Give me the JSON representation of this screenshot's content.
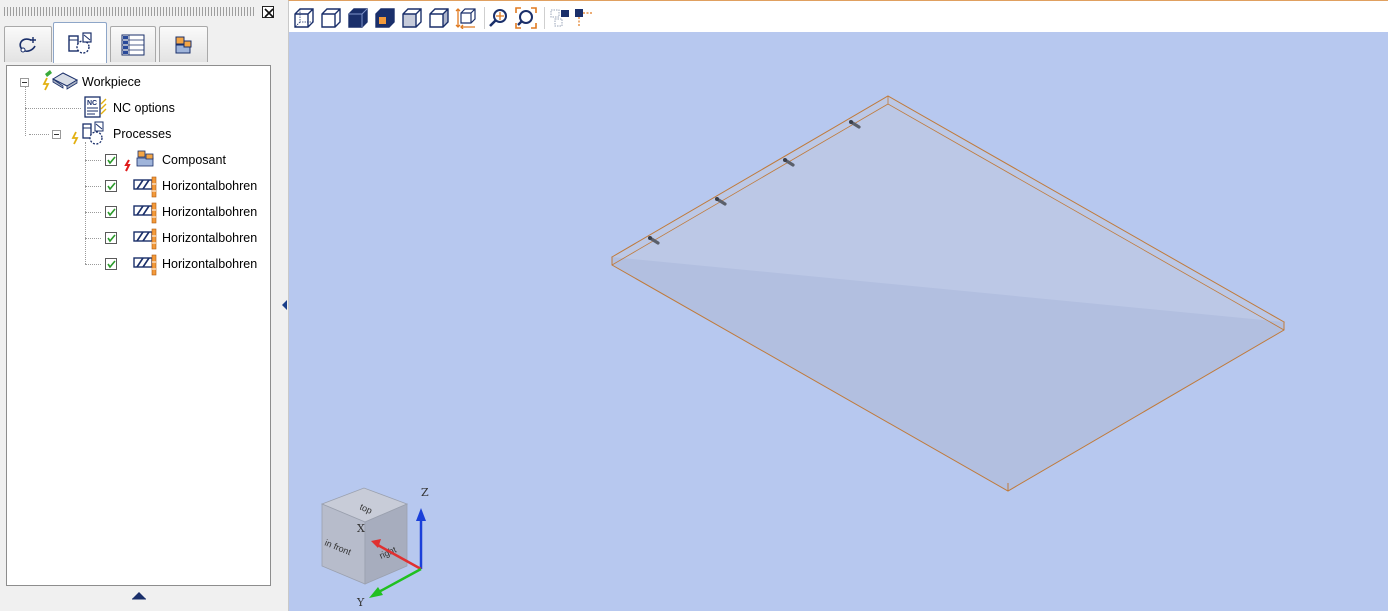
{
  "panel": {
    "tabs": [
      {
        "icon": "geometry-icon",
        "active": false
      },
      {
        "icon": "processes-icon",
        "active": true
      },
      {
        "icon": "nc-list-icon",
        "active": false
      },
      {
        "icon": "components-icon",
        "active": false
      }
    ]
  },
  "tree": {
    "workpiece": {
      "label": "Workpiece",
      "icon": "workpiece-icon",
      "expanded": true
    },
    "nc_options": {
      "label": "NC options",
      "icon": "nc-options-icon"
    },
    "processes": {
      "label": "Processes",
      "icon": "processes-icon",
      "expanded": true
    },
    "items": [
      {
        "label": "Composant",
        "icon": "composant-icon",
        "checked": true
      },
      {
        "label": "Horizontalbohren",
        "icon": "horizontal-drilling-icon",
        "checked": true
      },
      {
        "label": "Horizontalbohren",
        "icon": "horizontal-drilling-icon",
        "checked": true
      },
      {
        "label": "Horizontalbohren",
        "icon": "horizontal-drilling-icon",
        "checked": true
      },
      {
        "label": "Horizontalbohren",
        "icon": "horizontal-drilling-icon",
        "checked": true
      }
    ]
  },
  "toolbar": {
    "buttons": [
      "view-wireframe-icon",
      "view-hidden-lines-icon",
      "view-solid-icon",
      "view-shaded-icon",
      "view-iso-left-icon",
      "view-iso-right-icon",
      "view-dimensions-icon",
      "zoom-icon",
      "zoom-fit-icon",
      "select-icon",
      "snap-icon"
    ]
  },
  "viewcube": {
    "faces": {
      "top": "top",
      "front": "in front",
      "right": "right"
    },
    "axes": {
      "x": "X",
      "y": "Y",
      "z": "Z"
    }
  },
  "colors": {
    "viewport_bg": "#b7c8ef",
    "workpiece_edge": "#c07a3a",
    "axis_x": "#e03030",
    "axis_y": "#20c020",
    "axis_z": "#1a3fd9",
    "check": "#2a9a2a"
  }
}
